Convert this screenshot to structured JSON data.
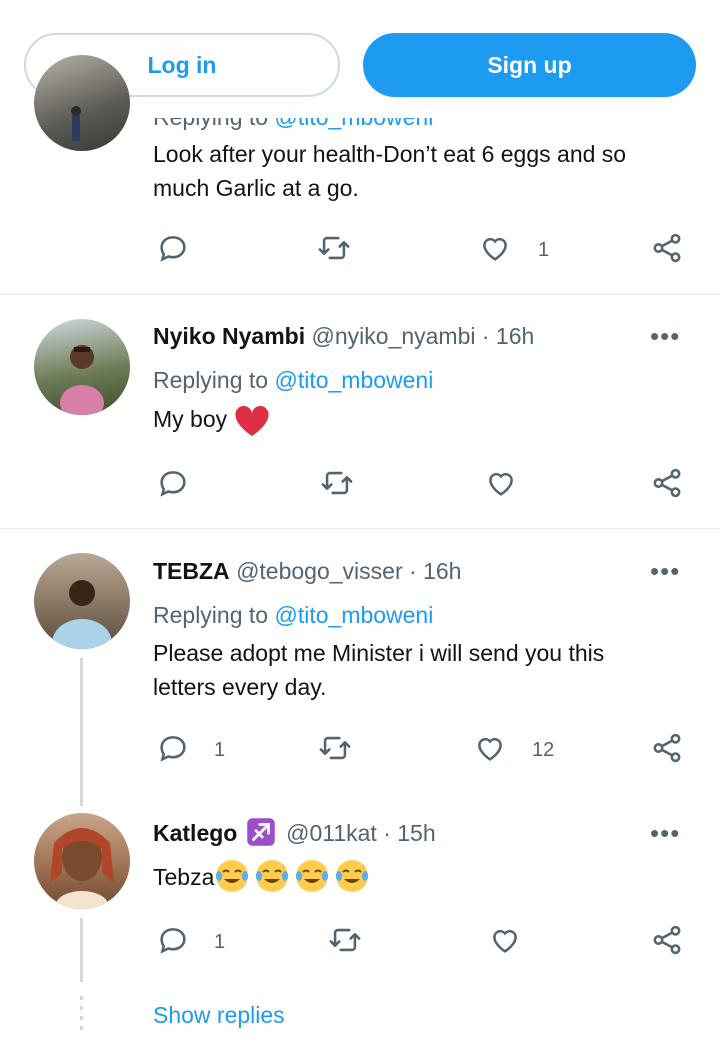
{
  "header": {
    "login_label": "Log in",
    "signup_label": "Sign up"
  },
  "tweets": [
    {
      "replying_prefix": "Replying to",
      "replying_handle": "@tito_mboweni",
      "text_line1": "Look after your health-Don’t eat 6 eggs and so",
      "text_line2": "much Garlic at a go.",
      "replies": "",
      "retweets": "",
      "likes": "1"
    },
    {
      "name": "Nyiko Nyambi",
      "handle": "@nyiko_nyambi",
      "time": "· 16h",
      "replying_prefix": "Replying to",
      "replying_handle": "@tito_mboweni",
      "text": "My boy",
      "replies": "",
      "retweets": "",
      "likes": ""
    },
    {
      "name": "TEBZA",
      "handle": "@tebogo_visser",
      "time": "· 16h",
      "replying_prefix": "Replying to",
      "replying_handle": "@tito_mboweni",
      "text_line1": "Please adopt me Minister i will send you this",
      "text_line2": "letters every day.",
      "replies": "1",
      "retweets": "",
      "likes": "12"
    },
    {
      "name": "Katlego",
      "handle": "@011kat",
      "time": "· 15h",
      "text": "Tebza",
      "replies": "1",
      "retweets": "",
      "likes": ""
    }
  ],
  "show_replies_label": "Show replies",
  "colors": {
    "accent": "#1d9bf0",
    "muted": "#536471",
    "heart": "#e0245e",
    "sagittarius": "#9b4dca"
  }
}
